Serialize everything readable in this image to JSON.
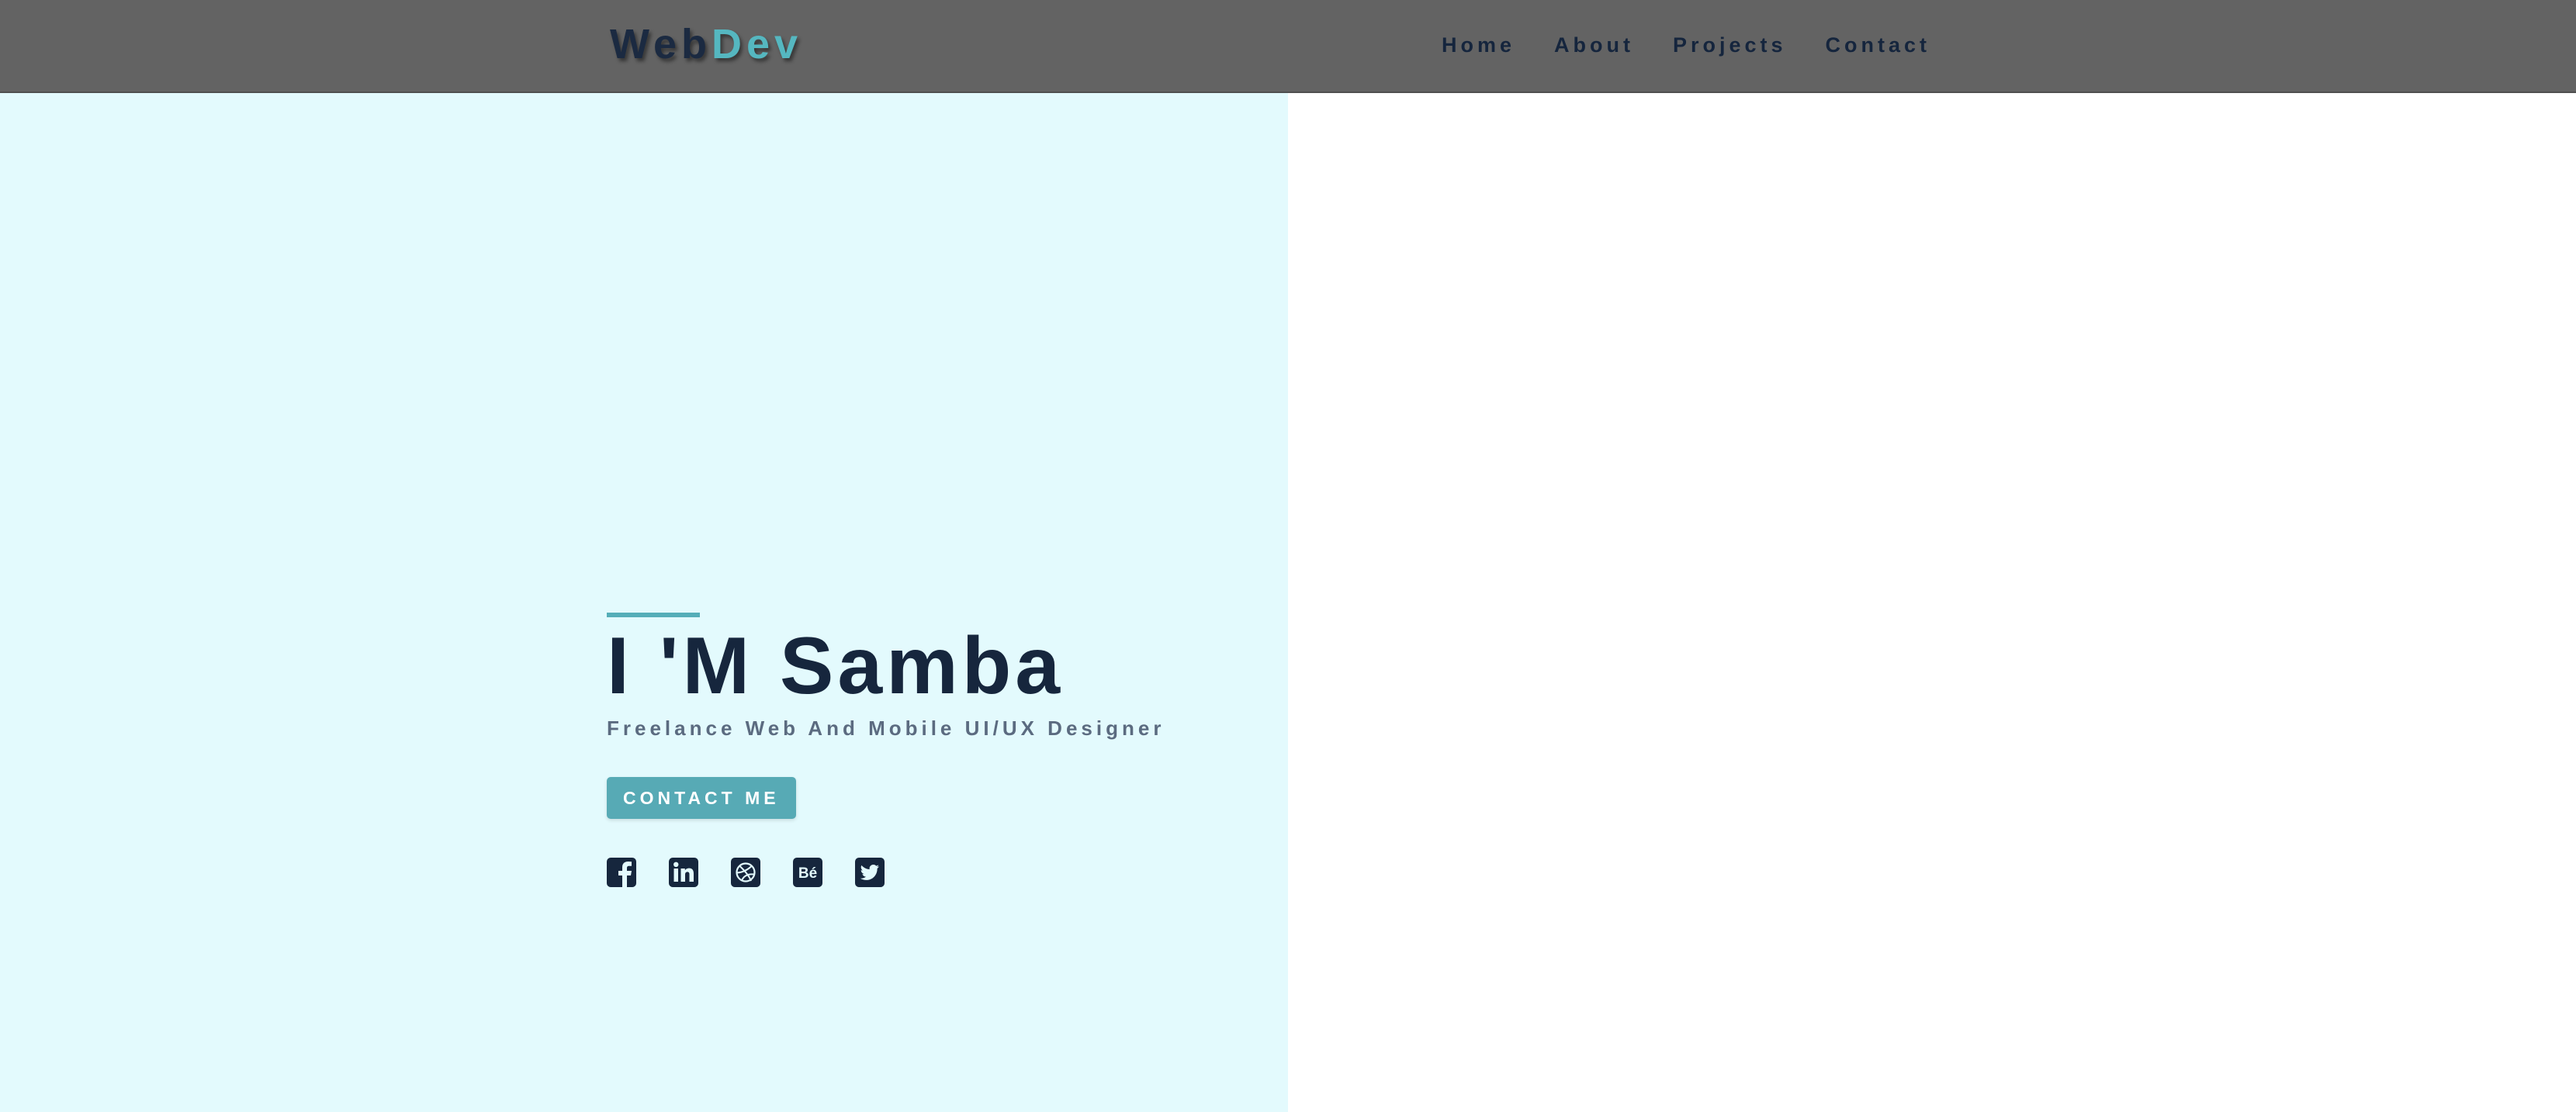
{
  "header": {
    "logo": {
      "part1": "Web",
      "part2": "Dev"
    },
    "nav": [
      {
        "label": "Home"
      },
      {
        "label": "About"
      },
      {
        "label": "Projects"
      },
      {
        "label": "Contact"
      }
    ]
  },
  "hero": {
    "title": "I 'M Samba",
    "subtitle": "Freelance Web And Mobile UI/UX Designer",
    "cta_label": "CONTACT ME",
    "social": [
      {
        "icon": "facebook-icon"
      },
      {
        "icon": "linkedin-icon"
      },
      {
        "icon": "dribbble-icon"
      },
      {
        "icon": "behance-icon",
        "text": "Bé"
      },
      {
        "icon": "twitter-icon"
      }
    ]
  },
  "colors": {
    "navbar": "#636363",
    "navy": "#16263d",
    "accent": "#55b7c0",
    "hero_bg": "#e3fafd",
    "subtitle": "#5b6b80"
  }
}
